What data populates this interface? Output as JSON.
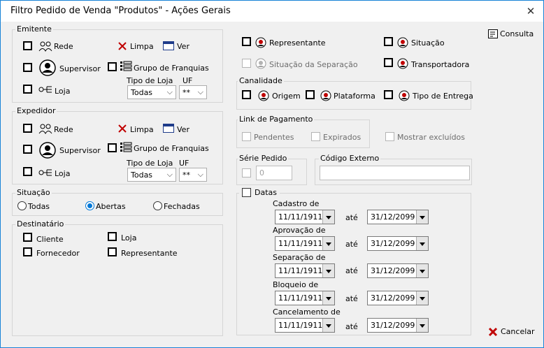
{
  "window": {
    "title": "Filtro Pedido de Venda \"Produtos\" - Ações Gerais",
    "close_glyph": "✕"
  },
  "emitente": {
    "legend": "Emitente",
    "rede": "Rede",
    "limpa": "Limpa",
    "ver": "Ver",
    "supervisor": "Supervisor",
    "grupo": "Grupo de Franquias",
    "loja": "Loja",
    "tipo_loja_label": "Tipo de Loja",
    "tipo_loja_value": "Todas",
    "uf_label": "UF",
    "uf_value": "**"
  },
  "expedidor": {
    "legend": "Expedidor",
    "rede": "Rede",
    "limpa": "Limpa",
    "ver": "Ver",
    "supervisor": "Supervisor",
    "grupo": "Grupo de Franquias",
    "loja": "Loja",
    "tipo_loja_label": "Tipo de Loja",
    "tipo_loja_value": "Todas",
    "uf_label": "UF",
    "uf_value": "**"
  },
  "situacao": {
    "legend": "Situação",
    "options": [
      "Todas",
      "Abertas",
      "Fechadas"
    ],
    "selected": "Abertas"
  },
  "destinatario": {
    "legend": "Destinatário",
    "cliente": "Cliente",
    "loja": "Loja",
    "fornecedor": "Fornecedor",
    "representante": "Representante"
  },
  "top_filters": {
    "representante": "Representante",
    "situacao": "Situação",
    "situacao_separacao": "Situação da Separação",
    "transportadora": "Transportadora"
  },
  "canalidade": {
    "legend": "Canalidade",
    "origem": "Origem",
    "plataforma": "Plataforma",
    "tipo_entrega": "Tipo de Entrega"
  },
  "link_pagamento": {
    "legend": "Link de Pagamento",
    "pendentes": "Pendentes",
    "expirados": "Expirados"
  },
  "mostrar_excluidos": "Mostrar excluídos",
  "serie_pedido": {
    "legend": "Série Pedido",
    "value": "0"
  },
  "codigo_externo": {
    "legend": "Código Externo",
    "value": ""
  },
  "datas": {
    "legend": "Datas",
    "ate": "até",
    "rows": [
      {
        "label": "Cadastro de",
        "from": "11/11/1911",
        "to": "31/12/2099"
      },
      {
        "label": "Aprovação de",
        "from": "11/11/1911",
        "to": "31/12/2099"
      },
      {
        "label": "Separação de",
        "from": "11/11/1911",
        "to": "31/12/2099"
      },
      {
        "label": "Bloqueio de",
        "from": "11/11/1911",
        "to": "31/12/2099"
      },
      {
        "label": "Cancelamento de",
        "from": "11/11/1911",
        "to": "31/12/2099"
      }
    ]
  },
  "buttons": {
    "consulta": "Consulta",
    "cancelar": "Cancelar"
  },
  "colors": {
    "accent": "#0078d7",
    "border": "#1883d7",
    "cancel_x": "#c00000"
  }
}
